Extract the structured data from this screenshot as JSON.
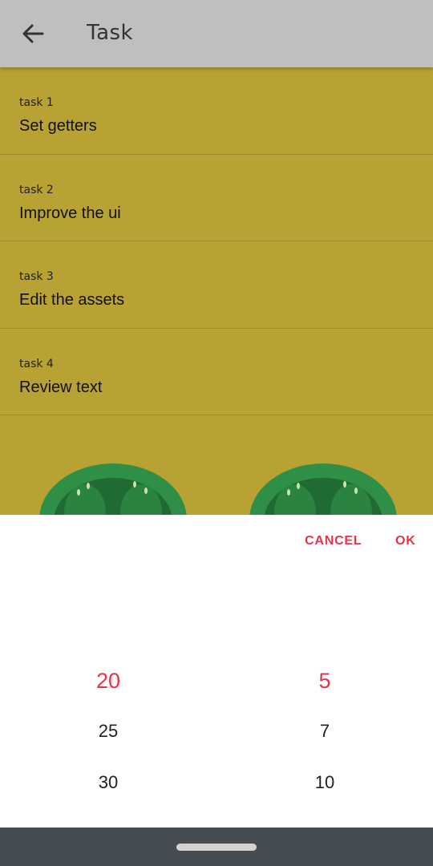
{
  "appbar": {
    "title": "Task"
  },
  "tasks": [
    {
      "label": "task 1",
      "text": "Set getters"
    },
    {
      "label": "task 2",
      "text": "Improve the ui"
    },
    {
      "label": "task 3",
      "text": "Edit the assets"
    },
    {
      "label": "task 4",
      "text": "Review text"
    }
  ],
  "picker": {
    "cancel_label": "CANCEL",
    "ok_label": "OK",
    "left_column": [
      "20",
      "25",
      "30"
    ],
    "right_column": [
      "5",
      "7",
      "10"
    ]
  },
  "colors": {
    "background": "#b7a233",
    "appbar": "#bfbfbf",
    "accent": "#e8344a",
    "tomato_green": "#2f8f46",
    "navbar": "#454c52"
  },
  "icons": [
    "back-arrow-icon",
    "tomato-illustration",
    "home-handle"
  ]
}
